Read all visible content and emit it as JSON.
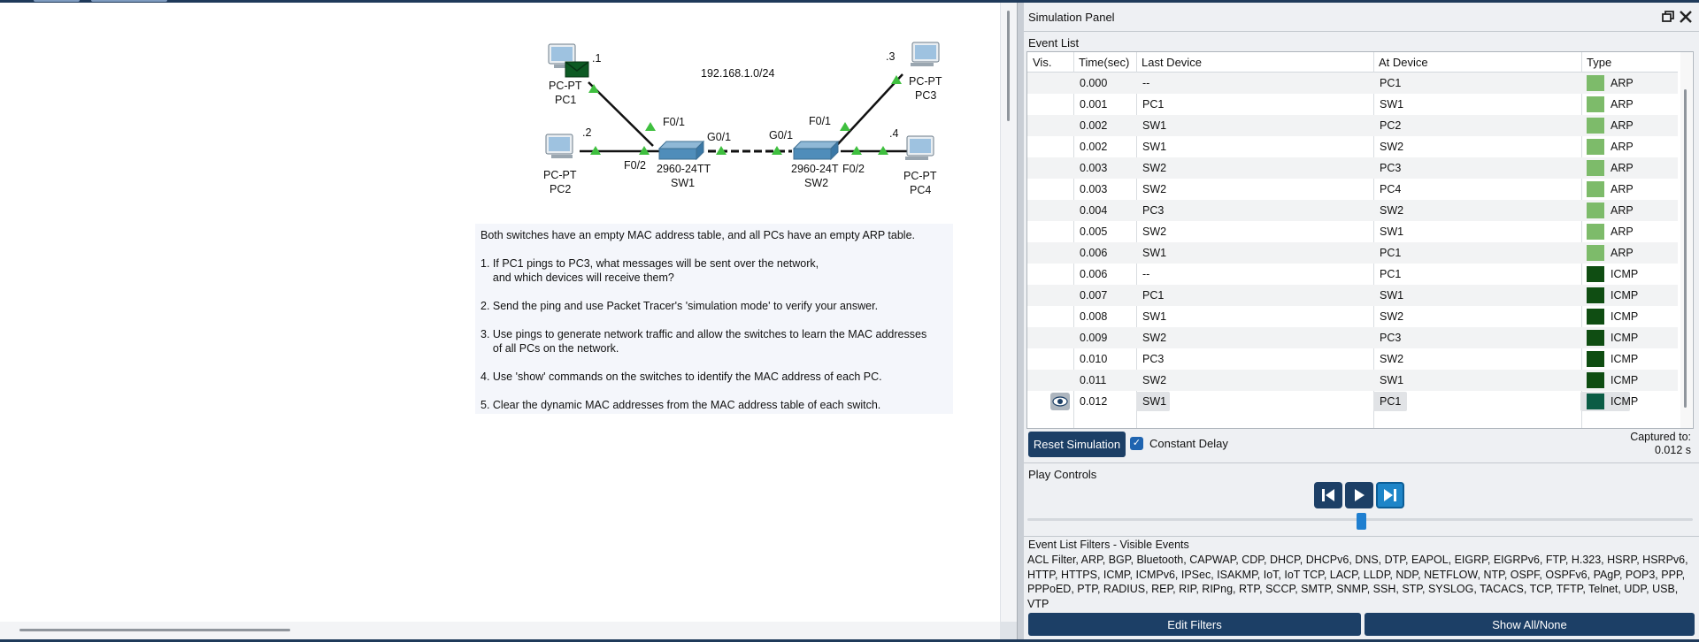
{
  "topology": {
    "network_label": "192.168.1.0/24",
    "devices": {
      "pc1": {
        "type": "PC-PT",
        "name": "PC1",
        "ip": ".1"
      },
      "pc2": {
        "type": "PC-PT",
        "name": "PC2",
        "ip": ".2"
      },
      "pc3": {
        "type": "PC-PT",
        "name": "PC3",
        "ip": ".3"
      },
      "pc4": {
        "type": "PC-PT",
        "name": "PC4",
        "ip": ".4"
      },
      "sw1": {
        "model": "2960-24TT",
        "name": "SW1"
      },
      "sw2": {
        "model": "2960-24T",
        "name": "SW2"
      }
    },
    "ports": {
      "sw1_f01": "F0/1",
      "sw1_f02": "F0/2",
      "sw1_g01": "G0/1",
      "sw2_g01": "G0/1",
      "sw2_f01": "F0/1",
      "sw2_f02": "F0/2"
    }
  },
  "instructions": {
    "intro": "Both switches have an empty MAC address table, and all PCs have an empty ARP table.",
    "q1_line1": "1. If PC1 pings to PC3, what messages will be sent over the network,",
    "q1_line2": "    and which devices will receive them?",
    "q2": "2. Send the ping and use Packet Tracer's 'simulation mode' to verify your answer.",
    "q3_line1": "3. Use pings to generate network traffic and allow the switches to learn the MAC addresses",
    "q3_line2": "    of all PCs on the network.",
    "q4": "4. Use 'show' commands on the switches to identify the MAC address of each PC.",
    "q5": "5. Clear the dynamic MAC addresses from the MAC address table of each switch."
  },
  "panel": {
    "title": "Simulation Panel",
    "event_list_label": "Event List",
    "columns": {
      "vis": "Vis.",
      "time": "Time(sec)",
      "last": "Last Device",
      "at": "At Device",
      "type": "Type"
    },
    "events": [
      {
        "time": "0.000",
        "last": "--",
        "at": "PC1",
        "type": "ARP",
        "color": "#7dbb6a"
      },
      {
        "time": "0.001",
        "last": "PC1",
        "at": "SW1",
        "type": "ARP",
        "color": "#7dbb6a"
      },
      {
        "time": "0.002",
        "last": "SW1",
        "at": "PC2",
        "type": "ARP",
        "color": "#7dbb6a"
      },
      {
        "time": "0.002",
        "last": "SW1",
        "at": "SW2",
        "type": "ARP",
        "color": "#7dbb6a"
      },
      {
        "time": "0.003",
        "last": "SW2",
        "at": "PC3",
        "type": "ARP",
        "color": "#7dbb6a"
      },
      {
        "time": "0.003",
        "last": "SW2",
        "at": "PC4",
        "type": "ARP",
        "color": "#7dbb6a"
      },
      {
        "time": "0.004",
        "last": "PC3",
        "at": "SW2",
        "type": "ARP",
        "color": "#7dbb6a"
      },
      {
        "time": "0.005",
        "last": "SW2",
        "at": "SW1",
        "type": "ARP",
        "color": "#7dbb6a"
      },
      {
        "time": "0.006",
        "last": "SW1",
        "at": "PC1",
        "type": "ARP",
        "color": "#7dbb6a"
      },
      {
        "time": "0.006",
        "last": "--",
        "at": "PC1",
        "type": "ICMP",
        "color": "#0f4d12"
      },
      {
        "time": "0.007",
        "last": "PC1",
        "at": "SW1",
        "type": "ICMP",
        "color": "#0f4d12"
      },
      {
        "time": "0.008",
        "last": "SW1",
        "at": "SW2",
        "type": "ICMP",
        "color": "#0f4d12"
      },
      {
        "time": "0.009",
        "last": "SW2",
        "at": "PC3",
        "type": "ICMP",
        "color": "#0f4d12"
      },
      {
        "time": "0.010",
        "last": "PC3",
        "at": "SW2",
        "type": "ICMP",
        "color": "#0f4d12"
      },
      {
        "time": "0.011",
        "last": "SW2",
        "at": "SW1",
        "type": "ICMP",
        "color": "#0f4d12"
      },
      {
        "time": "0.012",
        "last": "SW1",
        "at": "PC1",
        "type": "ICMP",
        "color": "#0b5c45",
        "current": true
      }
    ],
    "reset_label": "Reset Simulation",
    "constant_delay_label": "Constant Delay",
    "constant_delay_checked": true,
    "captured_label": "Captured to:",
    "captured_value": "0.012 s",
    "play_controls_label": "Play Controls",
    "filters_title": "Event List Filters - Visible Events",
    "filters_text": "ACL Filter, ARP, BGP, Bluetooth, CAPWAP, CDP, DHCP, DHCPv6, DNS, DTP, EAPOL, EIGRP, EIGRPv6, FTP, H.323, HSRP, HSRPv6, HTTP, HTTPS, ICMP, ICMPv6, IPSec, ISAKMP, IoT, IoT TCP, LACP, LLDP, NDP, NETFLOW, NTP, OSPF, OSPFv6, PAgP, POP3, PPP, PPPoED, PTP, RADIUS, REP, RIP, RIPng, RTP, SCCP, SMTP, SNMP, SSH, STP, SYSLOG, TACACS, TCP, TFTP, Telnet, UDP, USB, VTP",
    "edit_filters_label": "Edit Filters",
    "show_all_label": "Show All/None"
  }
}
